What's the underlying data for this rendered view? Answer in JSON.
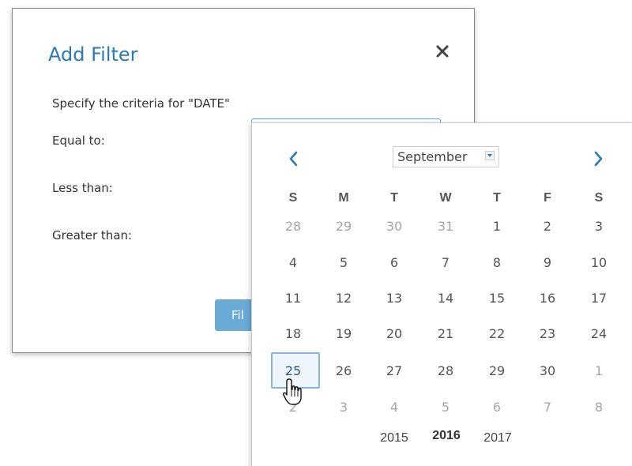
{
  "dialog": {
    "title": "Add Filter",
    "criteria_text": "Specify the criteria for \"DATE\"",
    "rows": {
      "equal_label": "Equal to:",
      "less_label": "Less than:",
      "greater_label": "Greater than:"
    },
    "filter_button_label": "Fil"
  },
  "calendar": {
    "month": "September",
    "weekdays": [
      "S",
      "M",
      "T",
      "W",
      "T",
      "F",
      "S"
    ],
    "weeks": [
      [
        "28",
        "29",
        "30",
        "31",
        "1",
        "2",
        "3"
      ],
      [
        "4",
        "5",
        "6",
        "7",
        "8",
        "9",
        "10"
      ],
      [
        "11",
        "12",
        "13",
        "14",
        "15",
        "16",
        "17"
      ],
      [
        "18",
        "19",
        "20",
        "21",
        "22",
        "23",
        "24"
      ],
      [
        "25",
        "26",
        "27",
        "28",
        "29",
        "30",
        "1"
      ],
      [
        "2",
        "3",
        "4",
        "5",
        "6",
        "7",
        "8"
      ]
    ],
    "selected_day": "25",
    "years": [
      "2015",
      "2016",
      "2017"
    ],
    "current_year": "2016"
  },
  "icons": {
    "close": "close-icon",
    "prev": "chevron-left-icon",
    "next": "chevron-right-icon",
    "cursor": "hand-pointer-icon"
  },
  "colors": {
    "accent": "#2a7ab8",
    "button": "#6aaad6",
    "selected_border": "#8ab4de"
  }
}
